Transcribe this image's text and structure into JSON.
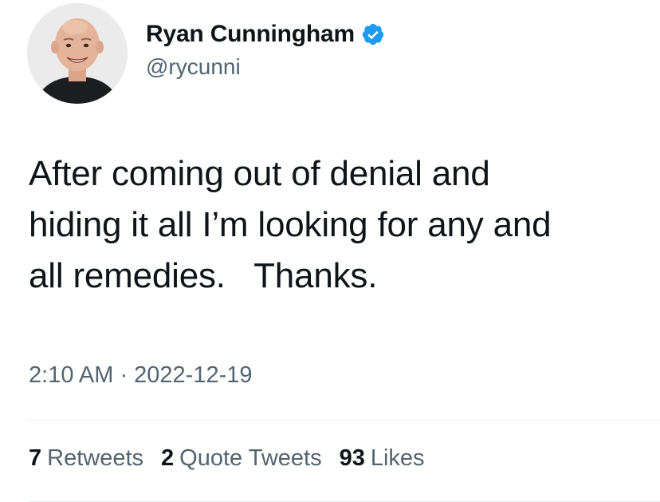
{
  "author": {
    "display_name": "Ryan Cunningham",
    "handle": "@rycunni",
    "verified": true
  },
  "tweet": {
    "text": "After coming out of denial and\nhiding it all I’m looking for any and\nall remedies.   Thanks.",
    "timestamp": "2:10 AM · 2022-12-19"
  },
  "stats": [
    {
      "count": "7",
      "label": "Retweets"
    },
    {
      "count": "2",
      "label": "Quote Tweets"
    },
    {
      "count": "93",
      "label": "Likes"
    }
  ],
  "colors": {
    "verified": "#1d9bf0",
    "secondary_text": "#536471",
    "primary_text": "#0f1419"
  }
}
